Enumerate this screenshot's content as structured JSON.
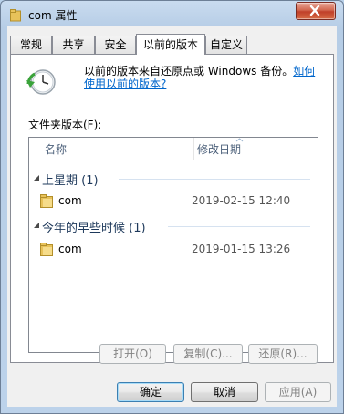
{
  "window": {
    "title": "com 属性"
  },
  "tabs": [
    "常规",
    "共享",
    "安全",
    "以前的版本",
    "自定义"
  ],
  "active_tab": 3,
  "info": {
    "text": "以前的版本来自还原点或 Windows 备份。",
    "link1": "如何",
    "link2": "使用以前的版本?"
  },
  "file_versions": {
    "label": "文件夹版本(F):",
    "columns": {
      "name": "名称",
      "modified": "修改日期"
    },
    "groups": [
      {
        "name": "上星期 (1)",
        "items": [
          {
            "name": "com",
            "date": "2019-02-15 12:40"
          }
        ]
      },
      {
        "name": "今年的早些时候 (1)",
        "items": [
          {
            "name": "com",
            "date": "2019-01-15 13:26"
          }
        ]
      }
    ]
  },
  "actions": {
    "open": "打开(O)",
    "copy": "复制(C)...",
    "restore": "还原(R)..."
  },
  "footer": {
    "ok": "确定",
    "cancel": "取消",
    "apply": "应用(A)"
  },
  "colors": {
    "link": "#0066cc",
    "group_header": "#1e395b",
    "close_button": "#c0402a"
  }
}
